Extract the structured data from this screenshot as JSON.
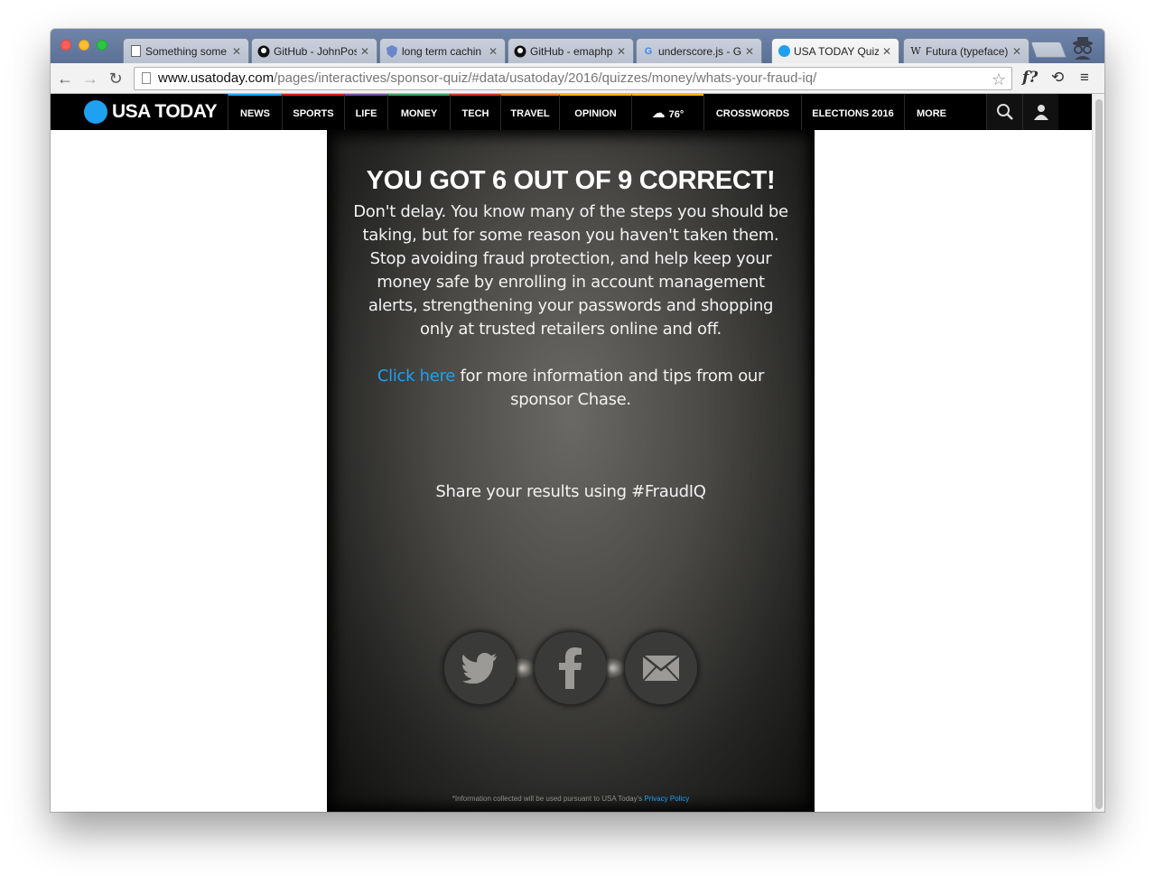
{
  "browser": {
    "tabs": [
      {
        "label": "Something some",
        "favicon": "page-icon"
      },
      {
        "label": "GitHub - JohnPos",
        "favicon": "github-icon"
      },
      {
        "label": "long term cachin",
        "favicon": "shield-icon"
      },
      {
        "label": "GitHub - emaphp",
        "favicon": "github-icon"
      },
      {
        "label": "underscore.js - G",
        "favicon": "google-icon"
      },
      {
        "label": "USA TODAY Quiz",
        "favicon": "usatoday-icon"
      },
      {
        "label": "Futura (typeface)",
        "favicon": "wikipedia-icon"
      }
    ],
    "url_host": "www.usatoday.com",
    "url_path": "/pages/interactives/sponsor-quiz/#data/usatoday/2016/quizzes/money/whats-your-fraud-iq/",
    "ext_fquestion": "f?"
  },
  "nav": {
    "brand": "USA TODAY",
    "items": [
      "NEWS",
      "SPORTS",
      "LIFE",
      "MONEY",
      "TECH",
      "TRAVEL",
      "OPINION"
    ],
    "weather": "76°",
    "items2": [
      "CROSSWORDS",
      "ELECTIONS 2016",
      "MORE"
    ],
    "accent_colors": {
      "news": "#1da1f2",
      "sports": "#d31f24",
      "life": "#7b4a9c",
      "money": "#3ca15d",
      "tech": "#cc3333",
      "travel": "#e87b1e",
      "opinion": "#f6b01b",
      "weather": "#f6b01b"
    }
  },
  "quiz": {
    "result": "YOU GOT 6 OUT OF 9 CORRECT!",
    "description": "Don't delay. You know many of the steps you should be taking, but for some reason you haven't taken them. Stop avoiding fraud protection, and help keep your money safe by enrolling in account management alerts, strengthening your passwords and shopping only at trusted retailers online and off.",
    "info_link": "Click here",
    "info_rest": "for more information and tips from our sponsor Chase.",
    "share": "Share your results using #FraudIQ",
    "footer_text": "*Information collected will be used pursuant to USA Today's",
    "footer_link": "Privacy Policy"
  }
}
